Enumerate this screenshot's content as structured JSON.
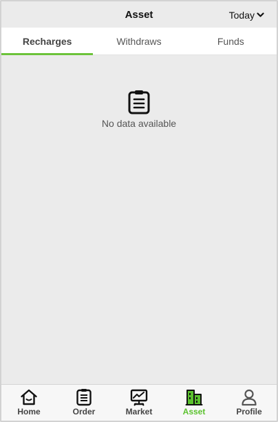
{
  "header": {
    "title": "Asset",
    "period_label": "Today"
  },
  "tabs": [
    {
      "label": "Recharges",
      "active": true
    },
    {
      "label": "Withdraws",
      "active": false
    },
    {
      "label": "Funds",
      "active": false
    }
  ],
  "empty_state": {
    "message": "No data available",
    "icon": "clipboard-list-icon"
  },
  "bottom_nav": [
    {
      "label": "Home",
      "icon": "home-icon",
      "active": false
    },
    {
      "label": "Order",
      "icon": "order-icon",
      "active": false
    },
    {
      "label": "Market",
      "icon": "market-chart-icon",
      "active": false
    },
    {
      "label": "Asset",
      "icon": "asset-buildings-icon",
      "active": true
    },
    {
      "label": "Profile",
      "icon": "profile-icon",
      "active": false
    }
  ],
  "colors": {
    "accent": "#6cc33a",
    "background": "#ebebeb"
  }
}
